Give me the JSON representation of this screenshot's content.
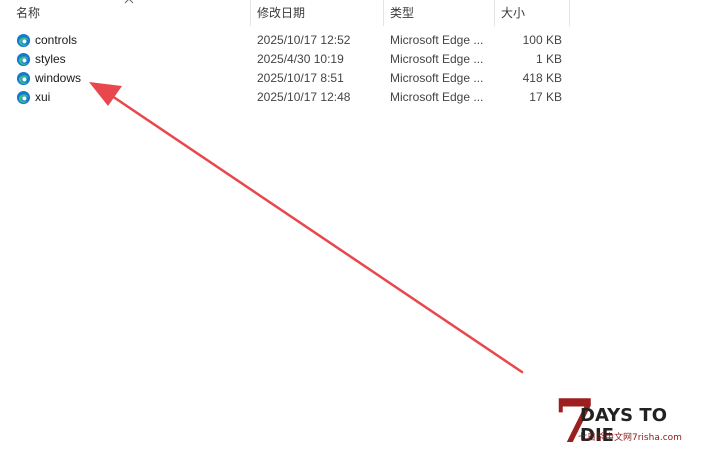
{
  "columns": {
    "name": "名称",
    "modified": "修改日期",
    "type": "类型",
    "size": "大小"
  },
  "files": [
    {
      "name": "controls",
      "modified": "2025/10/17 12:52",
      "type": "Microsoft Edge ...",
      "size": "100 KB",
      "icon": "edge-icon"
    },
    {
      "name": "styles",
      "modified": "2025/4/30 10:19",
      "type": "Microsoft Edge ...",
      "size": "1 KB",
      "icon": "edge-icon"
    },
    {
      "name": "windows",
      "modified": "2025/10/17 8:51",
      "type": "Microsoft Edge ...",
      "size": "418 KB",
      "icon": "edge-icon"
    },
    {
      "name": "xui",
      "modified": "2025/10/17 12:48",
      "type": "Microsoft Edge ...",
      "size": "17 KB",
      "icon": "edge-icon"
    }
  ],
  "annotation": {
    "arrow_color": "#e8474d",
    "points_to": "windows"
  },
  "watermark": {
    "logo_text": "7DAYS TO DIE",
    "site_text": "七日杀中文网7risha.com"
  },
  "colors": {
    "edge_blue": "#1479d1",
    "edge_green": "#3bbf8a",
    "watermark_red": "#9c1f1f"
  }
}
